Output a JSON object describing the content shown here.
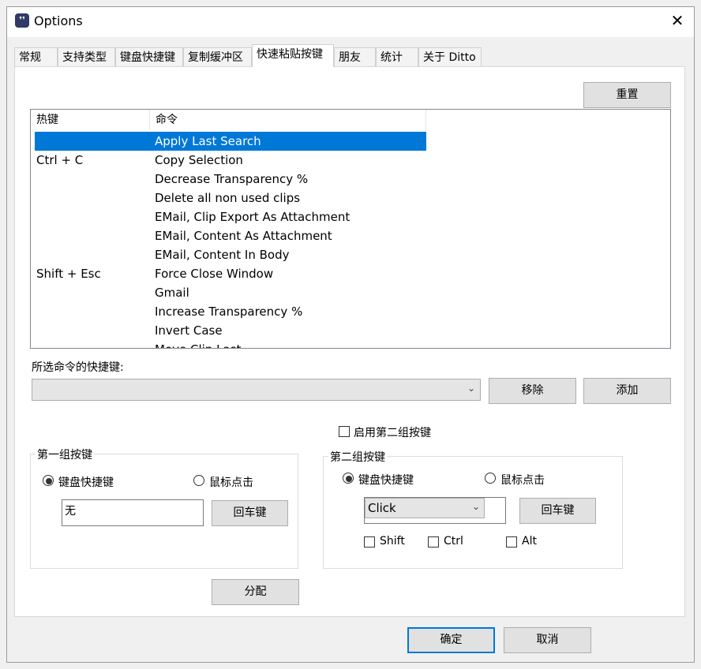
{
  "window": {
    "title": "Options",
    "app_icon": "ditto-app-icon"
  },
  "tabs": [
    {
      "label": "常规"
    },
    {
      "label": "支持类型"
    },
    {
      "label": "键盘快捷键"
    },
    {
      "label": "复制缓冲区"
    },
    {
      "label": "快速粘贴按键"
    },
    {
      "label": "朋友"
    },
    {
      "label": "统计"
    },
    {
      "label": "关于 Ditto"
    }
  ],
  "reset_label": "重置",
  "list": {
    "headers": {
      "hotkey": "热键",
      "command": "命令"
    },
    "rows": [
      {
        "hotkey": "",
        "command": "Apply Last Search"
      },
      {
        "hotkey": "Ctrl + C",
        "command": "Copy Selection"
      },
      {
        "hotkey": "",
        "command": "Decrease Transparency %"
      },
      {
        "hotkey": "",
        "command": "Delete all non used clips"
      },
      {
        "hotkey": "",
        "command": "EMail, Clip Export As Attachment"
      },
      {
        "hotkey": "",
        "command": "EMail, Content As Attachment"
      },
      {
        "hotkey": "",
        "command": "EMail, Content In Body"
      },
      {
        "hotkey": "Shift + Esc",
        "command": "Force Close Window"
      },
      {
        "hotkey": "",
        "command": "Gmail"
      },
      {
        "hotkey": "",
        "command": "Increase Transparency %"
      },
      {
        "hotkey": "",
        "command": "Invert Case"
      },
      {
        "hotkey": "",
        "command": "Move Clip Last"
      }
    ]
  },
  "selected_shortcut_label": "所选命令的快捷键:",
  "selected_shortcut_value": "",
  "remove_label": "移除",
  "add_label": "添加",
  "enable_second_label": "启用第二组按键",
  "group1": {
    "title": "第一组按键",
    "keyboard_label": "键盘快捷键",
    "mouse_label": "鼠标点击",
    "key_value": "无",
    "enter_label": "回车键"
  },
  "group2": {
    "title": "第二组按键",
    "keyboard_label": "键盘快捷键",
    "mouse_label": "鼠标点击",
    "combo_value": "Click",
    "enter_label": "回车键",
    "shift_label": "Shift",
    "ctrl_label": "Ctrl",
    "alt_label": "Alt"
  },
  "assign_label": "分配",
  "ok_label": "确定",
  "cancel_label": "取消"
}
